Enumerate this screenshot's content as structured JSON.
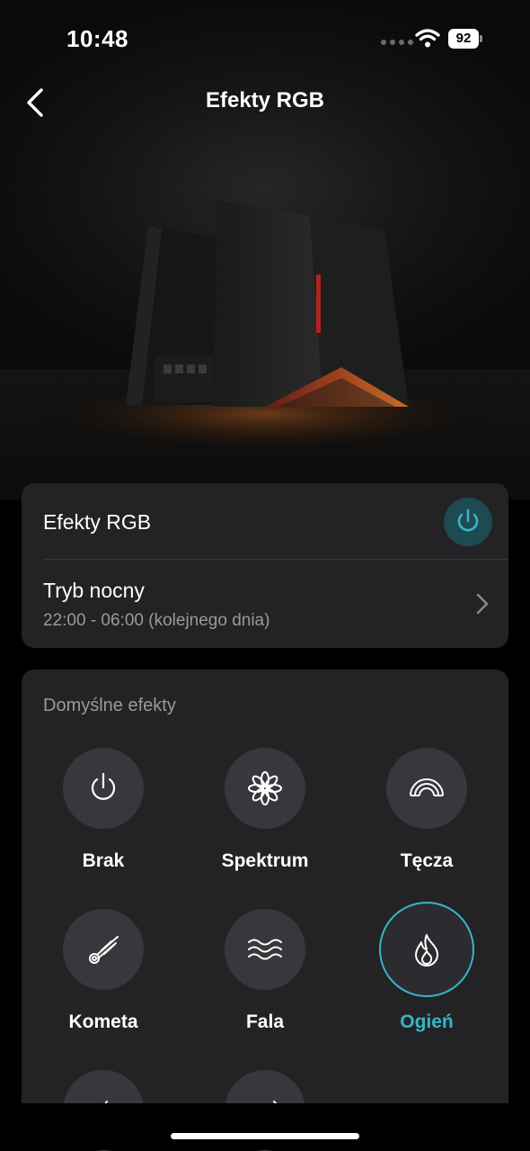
{
  "status": {
    "time": "10:48",
    "battery": "92"
  },
  "nav": {
    "title": "Efekty RGB",
    "back_icon": "chevron-left-icon"
  },
  "settings": {
    "rgb_label": "Efekty RGB",
    "rgb_power_state": "on",
    "night_mode_label": "Tryb nocny",
    "night_mode_time": "22:00 - 06:00 (kolejnego dnia)"
  },
  "effects": {
    "section_title": "Domyślne efekty",
    "items": [
      {
        "label": "Brak",
        "icon": "power-icon"
      },
      {
        "label": "Spektrum",
        "icon": "flower-icon"
      },
      {
        "label": "Tęcza",
        "icon": "rainbow-icon"
      },
      {
        "label": "Kometa",
        "icon": "comet-icon"
      },
      {
        "label": "Fala",
        "icon": "wave-icon"
      },
      {
        "label": "Ogień",
        "icon": "flame-icon",
        "selected": true
      }
    ]
  },
  "colors": {
    "accent": "#36b6c6",
    "card": "#232326",
    "power_bg": "#1e4a52"
  }
}
